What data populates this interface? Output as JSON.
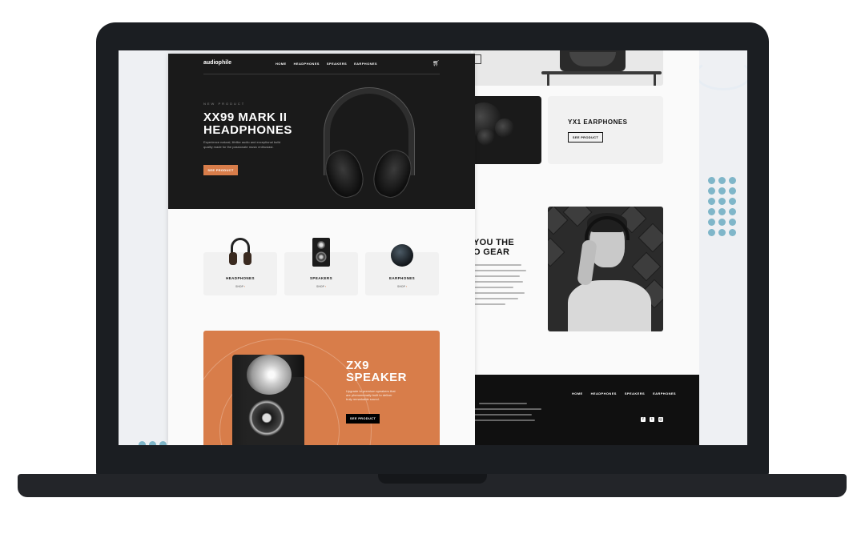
{
  "colors": {
    "accent": "#d87d4a",
    "dark": "#1a1a1a",
    "light": "#f1f1f1",
    "dots": "#7fb6c9"
  },
  "front": {
    "nav": {
      "logo": "audiophile",
      "links": [
        "HOME",
        "HEADPHONES",
        "SPEAKERS",
        "EARPHONES"
      ],
      "cart_icon": "cart-icon"
    },
    "hero": {
      "overline": "NEW PRODUCT",
      "title": "XX99 MARK II HEADPHONES",
      "description": "Experience natural, lifelike audio and exceptional build quality made for the passionate music enthusiast.",
      "button": "SEE PRODUCT"
    },
    "categories": [
      {
        "label": "HEADPHONES",
        "shop": "SHOP"
      },
      {
        "label": "SPEAKERS",
        "shop": "SHOP"
      },
      {
        "label": "EARPHONES",
        "shop": "SHOP"
      }
    ],
    "zx9": {
      "title": "ZX9 SPEAKER",
      "description": "Upgrade to premium speakers that are phenomenally built to deliver truly remarkable sound.",
      "button": "SEE PRODUCT"
    }
  },
  "back": {
    "yx1": {
      "title": "YX1 EARPHONES",
      "button": "SEE PRODUCT"
    },
    "about": {
      "title_line1": "YOU THE",
      "title_line2": "O GEAR"
    },
    "footer": {
      "links": [
        "HOME",
        "HEADPHONES",
        "SPEAKERS",
        "EARPHONES"
      ],
      "social": [
        "facebook-icon",
        "twitter-icon",
        "instagram-icon"
      ]
    }
  }
}
